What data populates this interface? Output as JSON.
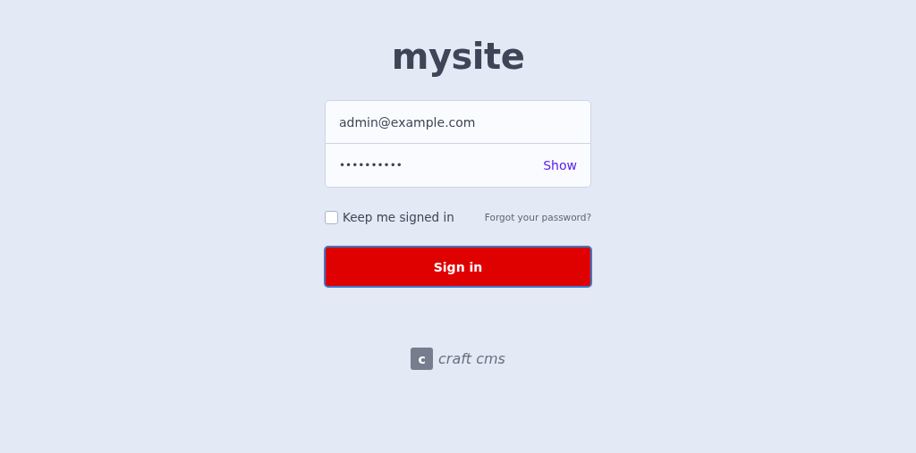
{
  "site_title": "mysite",
  "email": {
    "value": "admin@example.com"
  },
  "password": {
    "value": "••••••••••",
    "toggle": "Show"
  },
  "remember": {
    "label": "Keep me signed in",
    "checked": false
  },
  "forgot_link": "Forgot your password?",
  "submit": "Sign in",
  "footer": {
    "badge": "c",
    "text": "craft cms"
  }
}
